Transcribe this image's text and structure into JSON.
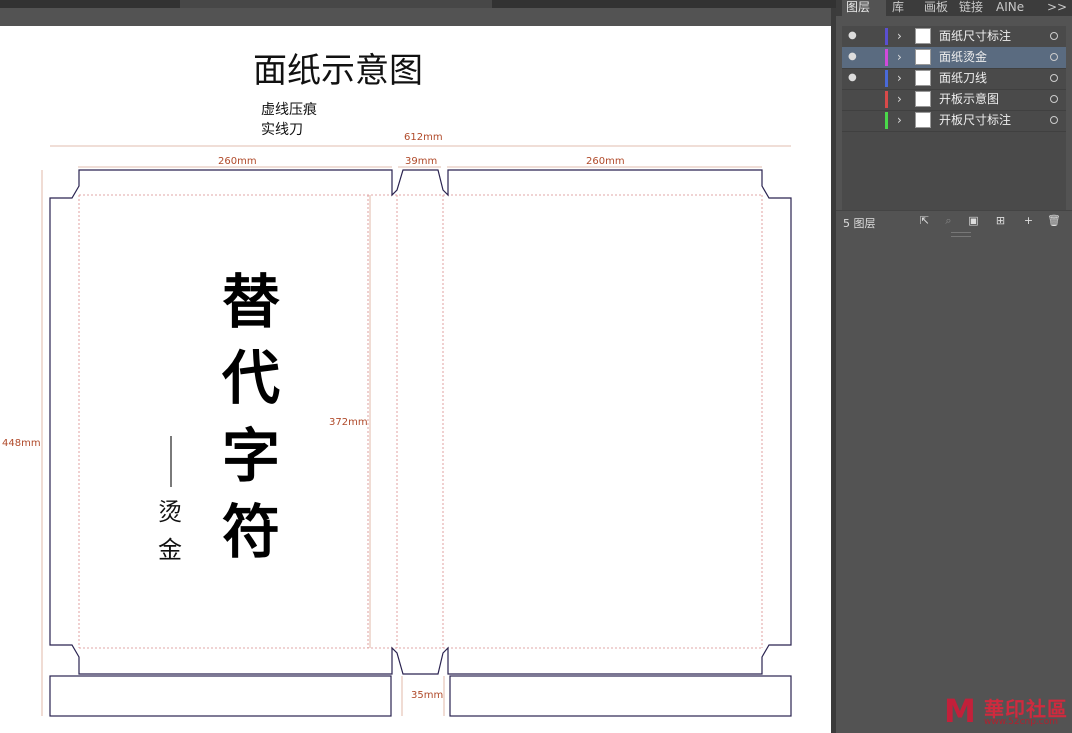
{
  "diagram": {
    "title": "面纸示意图",
    "legend": [
      "虚线压痕",
      "实线刀"
    ],
    "dimensions": {
      "total_width": "612mm",
      "panel_left": "260mm",
      "spine": "39mm",
      "panel_right": "260mm",
      "height_outer": "448mm",
      "height_inner": "372mm",
      "bottom_gap": "35mm"
    },
    "cover_text": [
      "替",
      "代",
      "字",
      "符"
    ],
    "foil_text": [
      "烫",
      "金"
    ]
  },
  "layers_panel": {
    "tabs": [
      "图层",
      "库",
      "画板",
      "链接",
      "AINe",
      ">>"
    ],
    "layers": [
      {
        "name": "面纸尺寸标注",
        "color": "#5a4fd0",
        "visible": true,
        "selected": false
      },
      {
        "name": "面纸烫金",
        "color": "#d04adb",
        "visible": true,
        "selected": true
      },
      {
        "name": "面纸刀线",
        "color": "#4a6ad8",
        "visible": true,
        "selected": false
      },
      {
        "name": "开板示意图",
        "color": "#d84a4a",
        "visible": false,
        "selected": false
      },
      {
        "name": "开板尺寸标注",
        "color": "#4ad84a",
        "visible": false,
        "selected": false
      }
    ],
    "footer": {
      "count_label": "5 图层"
    }
  },
  "watermark": {
    "name": "華印社區",
    "url": "www.52cnp.com"
  }
}
